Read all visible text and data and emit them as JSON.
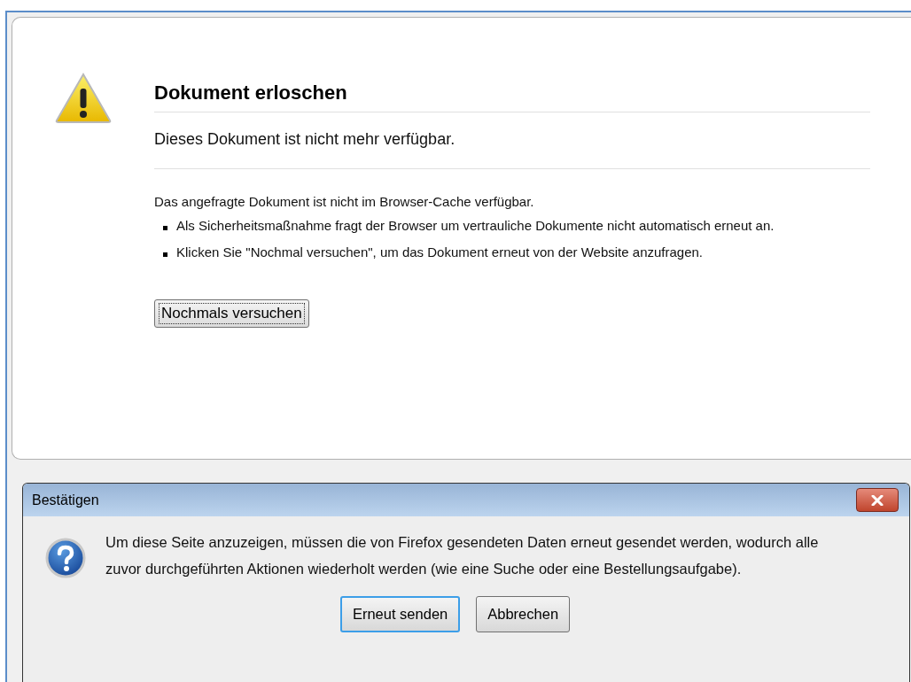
{
  "error_page": {
    "title": "Dokument erloschen",
    "subtitle": "Dieses Dokument ist nicht mehr verfügbar.",
    "intro": "Das angefragte Dokument ist nicht im Browser-Cache verfügbar.",
    "bullets": [
      "Als Sicherheitsmaßnahme fragt der Browser um vertrauliche Dokumente nicht automatisch erneut an.",
      "Klicken Sie \"Nochmal versuchen\", um das Dokument erneut von der Website anzufragen."
    ],
    "retry_button": {
      "label": "Nochmals versuchen",
      "focused": true
    }
  },
  "dialog": {
    "title": "Bestätigen",
    "message": "Um diese Seite anzuzeigen, müssen die von Firefox gesendeten Daten erneut gesendet werden, wodurch alle zuvor durchgeführten Aktionen wiederholt werden (wie eine Suche oder eine Bestellungsaufgabe).",
    "buttons": [
      {
        "label": "Erneut senden",
        "default": true
      },
      {
        "label": "Abbrechen",
        "default": false
      }
    ]
  }
}
